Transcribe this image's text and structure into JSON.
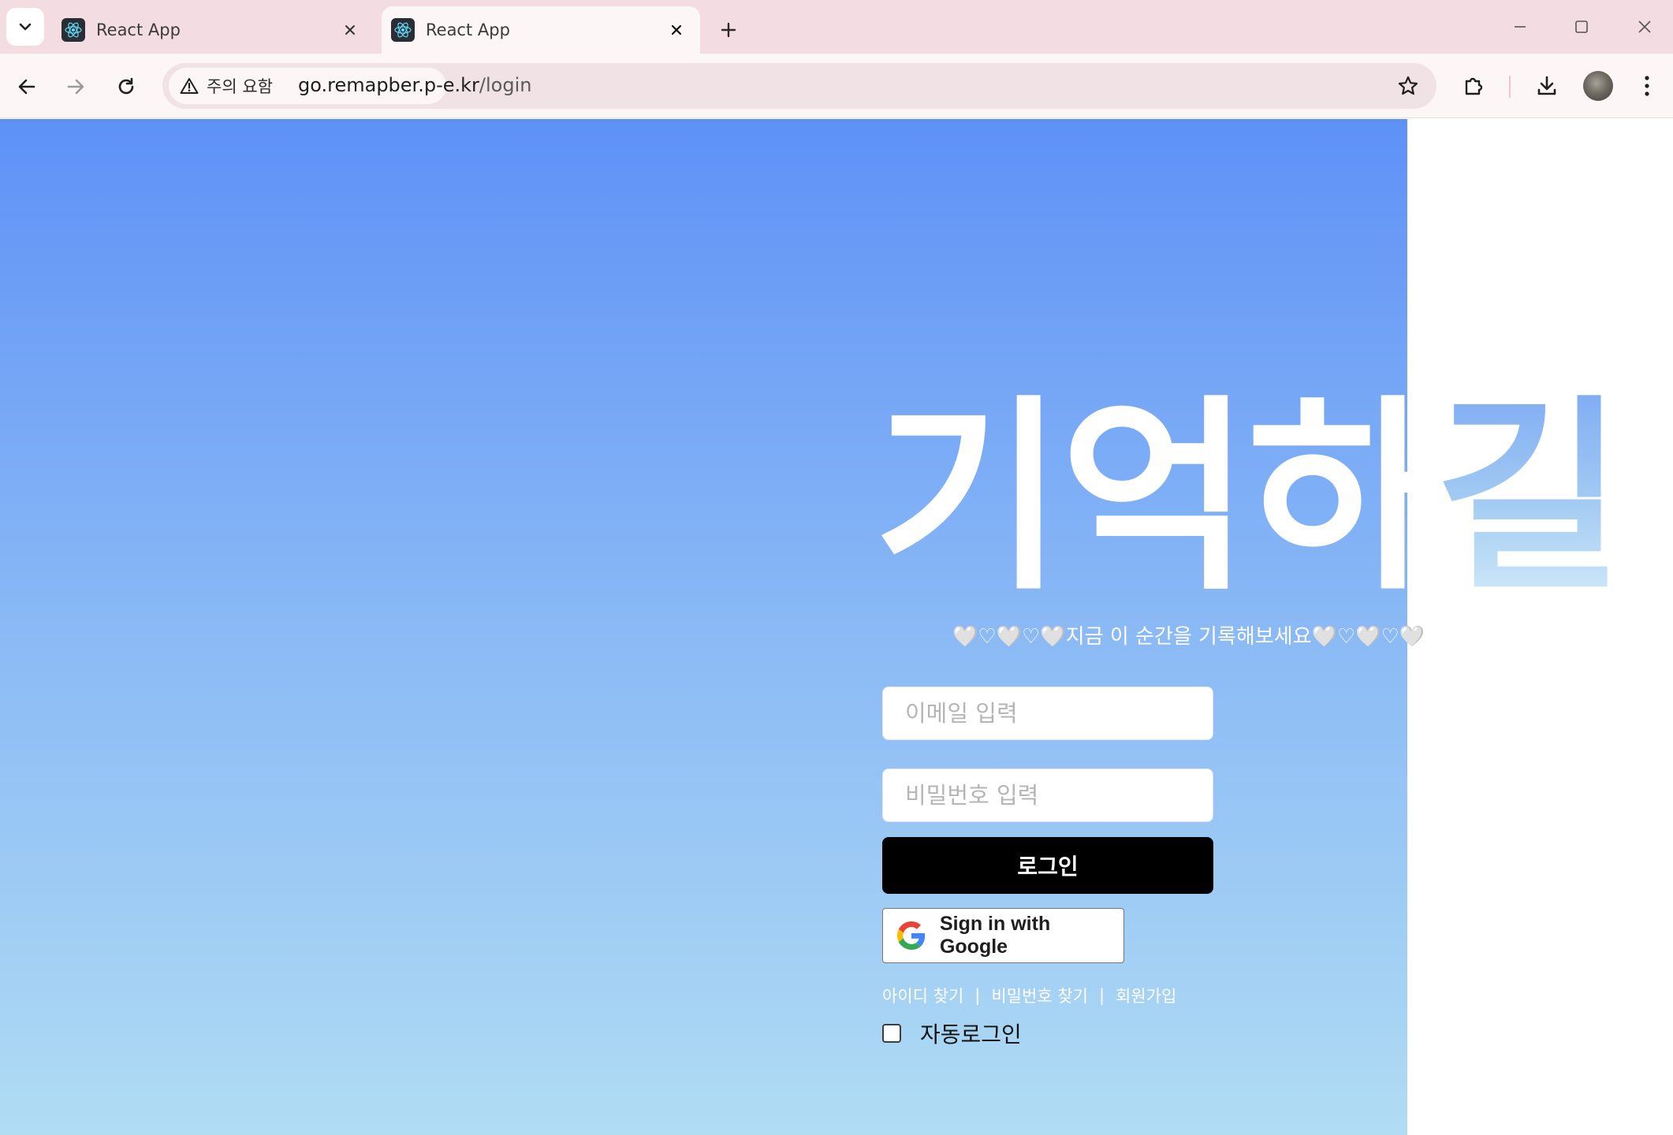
{
  "browser": {
    "tabs": [
      {
        "title": "React App",
        "active": false
      },
      {
        "title": "React App",
        "active": true
      }
    ],
    "security_chip": "주의 요함",
    "url": {
      "host": "go.remapber.p-e.kr",
      "path": "/login"
    }
  },
  "page": {
    "logo": {
      "main": "기억하",
      "last": "길"
    },
    "tagline": "🤍♡🤍♡🤍지금 이 순간을 기록해보세요🤍♡🤍♡🤍",
    "email_placeholder": "이메일 입력",
    "password_placeholder": "비밀번호 입력",
    "login_button": "로그인",
    "google_button": "Sign in with Google",
    "links": {
      "find_id": "아이디 찾기",
      "find_password": "비밀번호 찾기",
      "signup": "회원가입",
      "separator": "|"
    },
    "auto_login_label": "자동로그인",
    "auto_login_checked": false
  },
  "colors": {
    "gradient_top": "#5e91f7",
    "gradient_bottom": "#b0dcf4",
    "login_button_bg": "#000000",
    "tabstrip_bg": "#f3dde2"
  }
}
